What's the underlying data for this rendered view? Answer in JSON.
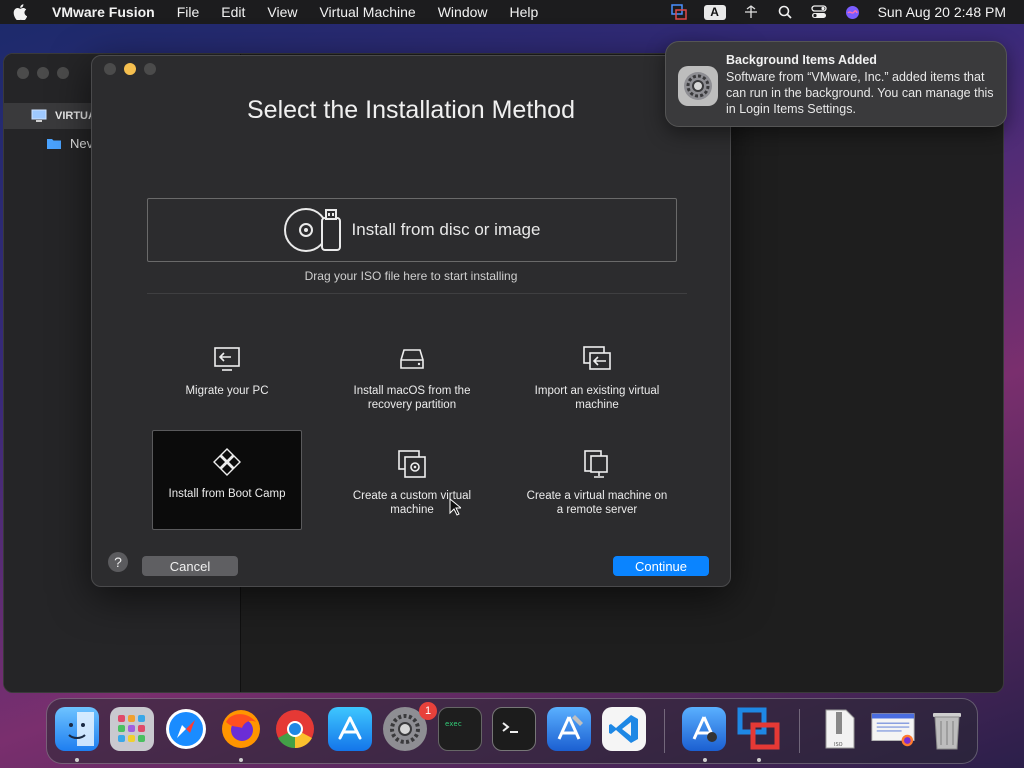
{
  "menubar": {
    "app_name": "VMware Fusion",
    "items": [
      "File",
      "Edit",
      "View",
      "Virtual Machine",
      "Window",
      "Help"
    ],
    "ime_label": "A",
    "clock": "Sun Aug 20  2:48 PM"
  },
  "library": {
    "selected_row": "VIRTUA",
    "sub_row": "Nev"
  },
  "assistant": {
    "title": "Select the Installation Method",
    "disc_option": "Install from disc or image",
    "drag_hint": "Drag your ISO file here to start installing",
    "options": [
      {
        "label": "Migrate your PC"
      },
      {
        "label": "Install macOS from the recovery partition"
      },
      {
        "label": "Import an existing virtual machine"
      },
      {
        "label": "Install from Boot Camp"
      },
      {
        "label": "Create a custom virtual machine"
      },
      {
        "label": "Create a virtual machine on a remote server"
      }
    ],
    "help_label": "?",
    "cancel_label": "Cancel",
    "continue_label": "Continue"
  },
  "notification": {
    "title": "Background Items Added",
    "body": "Software from “VMware, Inc.” added items that can run in the background. You can manage this in Login Items Settings."
  },
  "dock": {
    "apps": [
      "Finder",
      "Launchpad",
      "Safari",
      "Firefox",
      "Chrome",
      "App Store",
      "System Settings",
      "Console",
      "Terminal",
      "Xcode",
      "Visual Studio Code",
      "Instruments",
      "VMware Fusion",
      "Archive",
      "Preview",
      "Trash"
    ],
    "settings_badge": "1"
  },
  "colors": {
    "accent": "#0a84ff",
    "minimize": "#f5bf4f",
    "badge": "#e8413b"
  }
}
